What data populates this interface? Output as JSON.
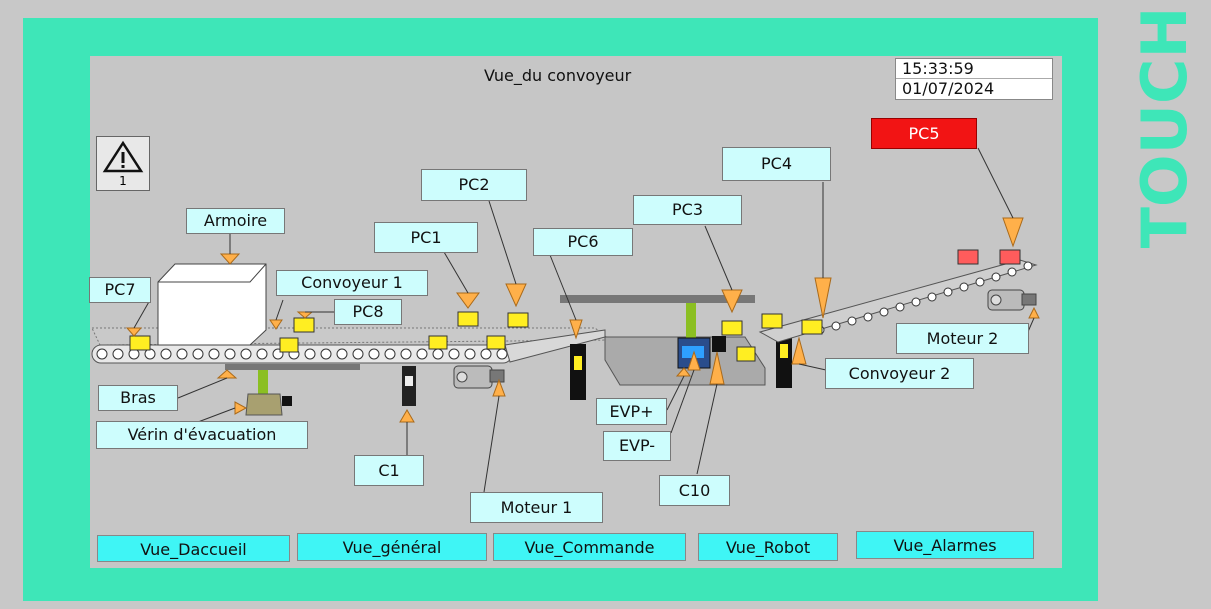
{
  "window": {
    "title": "Vue_du convoyeur",
    "brand": "TOUCH"
  },
  "clock": {
    "time": "15:33:59",
    "date": "01/07/2024"
  },
  "alarm": {
    "icon": "warning-triangle",
    "count": "1"
  },
  "labels": {
    "armoire": "Armoire",
    "pc7": "PC7",
    "convoyeur1": "Convoyeur 1",
    "pc8": "PC8",
    "pc1": "PC1",
    "pc2": "PC2",
    "pc6": "PC6",
    "pc3": "PC3",
    "pc4": "PC4",
    "pc5": "PC5",
    "moteur2": "Moteur 2",
    "convoyeur2": "Convoyeur 2",
    "bras": "Bras",
    "verin": "Vérin d'évacuation",
    "c1": "C1",
    "moteur1": "Moteur 1",
    "evp_plus": "EVP+",
    "evp_minus": "EVP-",
    "c10": "C10"
  },
  "nav": {
    "accueil": "Vue_Daccueil",
    "general": "Vue_général",
    "commande": "Vue_Commande",
    "robot": "Vue_Robot",
    "alarmes": "Vue_Alarmes"
  },
  "colors": {
    "frame": "#3ee6b8",
    "label_bg": "#cdfdfd",
    "nav_bg": "#3ff5f5",
    "alert": "#f21414",
    "sensor": "#ffee22",
    "arrow": "#ffb04a"
  }
}
